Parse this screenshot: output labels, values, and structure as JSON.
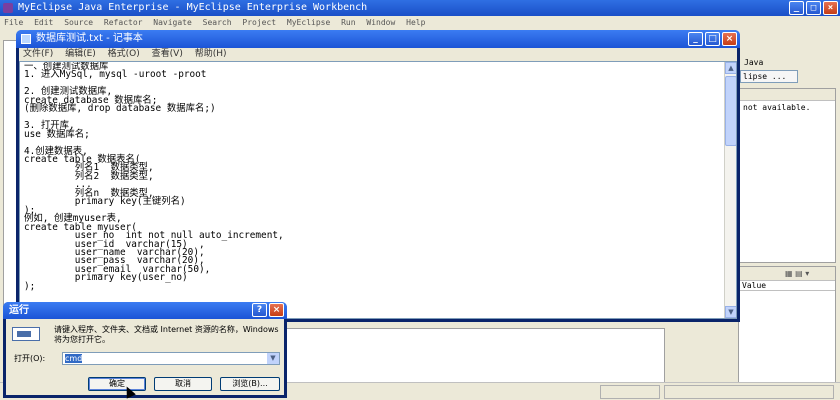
{
  "eclipse": {
    "title": "MyEclipse Java Enterprise - MyEclipse Enterprise Workbench",
    "menu": [
      "File",
      "Edit",
      "Source",
      "Refactor",
      "Navigate",
      "Search",
      "Project",
      "MyEclipse",
      "Run",
      "Window",
      "Help"
    ],
    "right_label": "Java",
    "right_button": "lipse ...",
    "outline_message": "not available.",
    "props_column": "Value"
  },
  "notepad": {
    "title": "数据库测试.txt - 记事本",
    "menu": [
      "文件(F)",
      "编辑(E)",
      "格式(O)",
      "查看(V)",
      "帮助(H)"
    ],
    "text": "一、创建测试数据库\n1. 进入MySql, mysql -uroot -proot\n\n2. 创建测试数据库,\ncreate database 数据库名;\n(删除数据库, drop database 数据库名;)\n\n3. 打开库,\nuse 数据库名;\n\n4.创建数据表,\ncreate table 数据表名(\n         列名1  数据类型,\n         列名2  数据类型,\n         ...\n         列名n  数据类型,\n         primary key(主键列名)\n);\n例如, 创建myuser表,\ncreate table myuser(\n         user_no  int not null auto_increment,\n         user_id  varchar(15)  ,\n         user_name  varchar(20),\n         user_pass  varchar(20),\n         user_email  varchar(50),\n         primary key(user_no)\n);"
  },
  "run_dialog": {
    "title": "运行",
    "description": "请键入程序、文件夹、文档或 Internet 资源的名称，Windows 将为您打开它。",
    "open_label": "打开(O):",
    "input_value": "cmd",
    "ok_label": "确定",
    "cancel_label": "取消",
    "browse_label": "浏览(B)..."
  }
}
